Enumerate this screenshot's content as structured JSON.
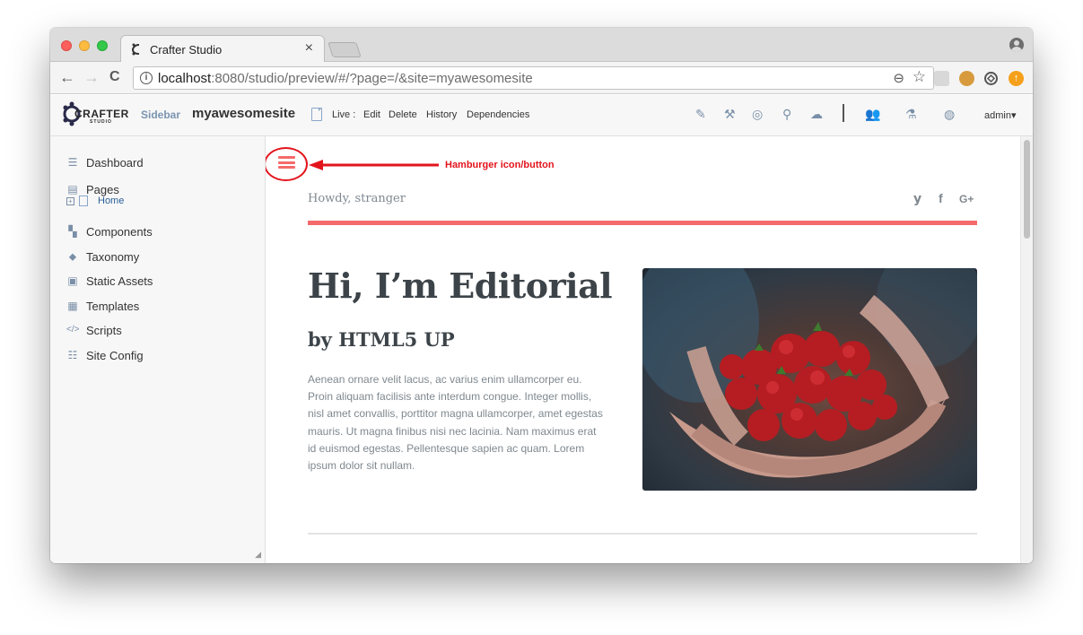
{
  "browser": {
    "tab_title": "Crafter Studio",
    "tab_close": "×",
    "url_host": "localhost",
    "url_rest": ":8080/studio/preview/#/?page=/&site=myawesomesite",
    "info_glyph": "i",
    "back_glyph": "←",
    "forward_glyph": "→",
    "reload_glyph": "C",
    "zoom_glyph": "⊖",
    "star_glyph": "☆",
    "icons": [
      "back-icon",
      "forward-icon",
      "reload-icon",
      "info-icon",
      "zoom-icon",
      "bookmark-star-icon",
      "trello-extension-icon",
      "cookie-extension-icon",
      "sync-extension-icon",
      "upload-extension-icon",
      "profile-icon"
    ]
  },
  "crafter_bar": {
    "logo_text": "CRAFTER",
    "logo_sub": "STUDIO",
    "sidebar_label": "Sidebar",
    "site_name": "myawesomesite",
    "live_label": "Live :",
    "links": [
      "Edit",
      "Delete",
      "History",
      "Dependencies"
    ],
    "right_icons": [
      "pencil-icon",
      "wrench-icon",
      "target-icon",
      "search-icon",
      "cloud-upload-icon",
      "users-icon",
      "sitemap-icon",
      "help-ring-icon"
    ],
    "admin_label": "admin▾"
  },
  "sidebar": {
    "items": [
      {
        "label": "Dashboard",
        "icon": "dashboard-icon"
      },
      {
        "label": "Pages",
        "icon": "pages-icon"
      },
      {
        "label": "Components",
        "icon": "components-icon"
      },
      {
        "label": "Taxonomy",
        "icon": "taxonomy-icon"
      },
      {
        "label": "Static Assets",
        "icon": "static-assets-icon"
      },
      {
        "label": "Templates",
        "icon": "templates-icon"
      },
      {
        "label": "Scripts",
        "icon": "scripts-icon"
      },
      {
        "label": "Site Config",
        "icon": "site-config-icon"
      }
    ],
    "pages_child": "Home",
    "expand_glyph": "+",
    "grip_glyph": "◢"
  },
  "preview": {
    "annotation": "Hamburger icon/button",
    "howdy": "Howdy, stranger",
    "social": [
      "𝘆",
      "f",
      "G+"
    ],
    "title": "Hi, I’m Editorial",
    "subtitle": "by HTML5 UP",
    "body": "Aenean ornare velit lacus, ac varius enim ullamcorper eu. Proin aliquam facilisis ante interdum congue. Integer mollis, nisl amet convallis, porttitor magna ullamcorper, amet egestas mauris. Ut magna finibus nisi nec lacinia. Nam maximus erat id euismod egestas. Pellentesque sapien ac quam. Lorem ipsum dolor sit nullam.",
    "image_desc": "strawberries-in-hands-image"
  },
  "colors": {
    "accent": "#f56a6a",
    "annotation_red": "#e3141c",
    "heading": "#3d4449",
    "body_text": "#7f888f"
  }
}
